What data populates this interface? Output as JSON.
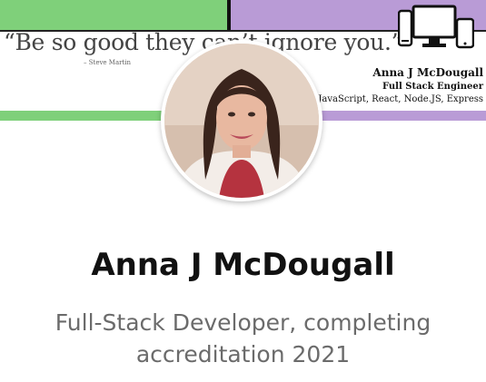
{
  "banner": {
    "quote": "“Be so good they can’t ignore you.”",
    "quote_attribution": "– Steve Martin",
    "name": "Anna J McDougall",
    "role": "Full Stack Engineer",
    "tech": "JavaScript, React, Node.JS, Express",
    "icon": "devices-icon",
    "colors": {
      "green": "#7fd07a",
      "purple": "#b99bd6"
    }
  },
  "profile": {
    "name": "Anna J McDougall",
    "headline": "Full-Stack Developer, completing accreditation 2021"
  }
}
